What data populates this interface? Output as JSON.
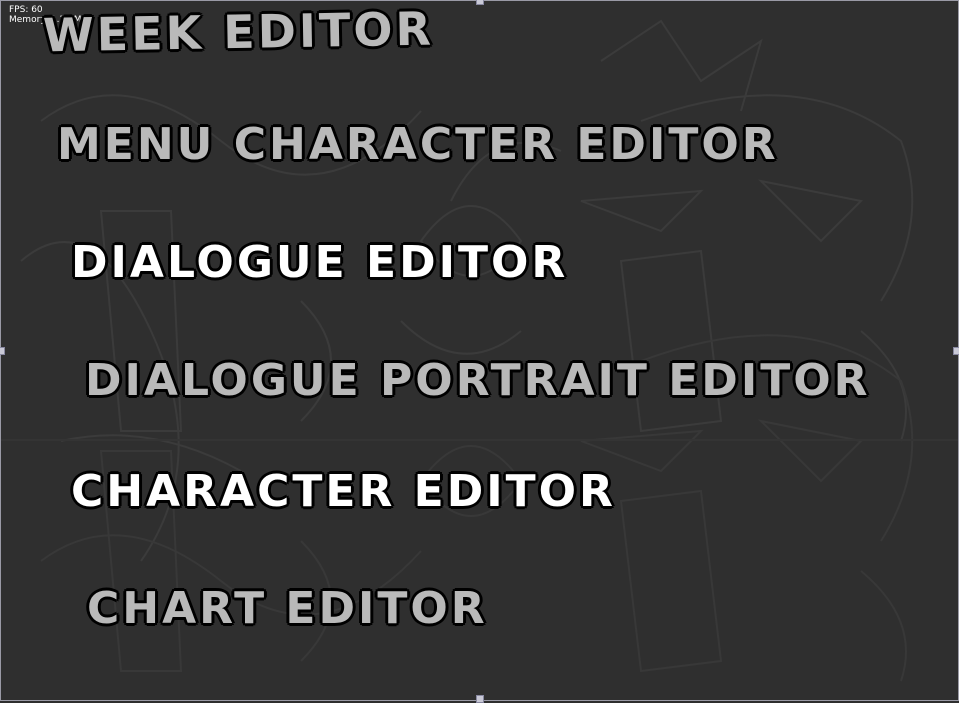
{
  "debug": {
    "fps_label": "FPS: 60",
    "memory_label": "Memory: 1.22 MB"
  },
  "menu": {
    "items": [
      {
        "label": "WEEK EDITOR",
        "state": "dim"
      },
      {
        "label": "MENU CHARACTER EDITOR",
        "state": "dim"
      },
      {
        "label": "DIALOGUE EDITOR",
        "state": "highlighted"
      },
      {
        "label": "DIALOGUE PORTRAIT EDITOR",
        "state": "dim"
      },
      {
        "label": "CHARACTER EDITOR",
        "state": "highlighted"
      },
      {
        "label": "CHART EDITOR",
        "state": "dim"
      }
    ]
  },
  "colors": {
    "background": "#2f2f2f",
    "dim_text": "#b9b9b9",
    "highlight_text": "#ffffff",
    "outline": "#000000"
  }
}
